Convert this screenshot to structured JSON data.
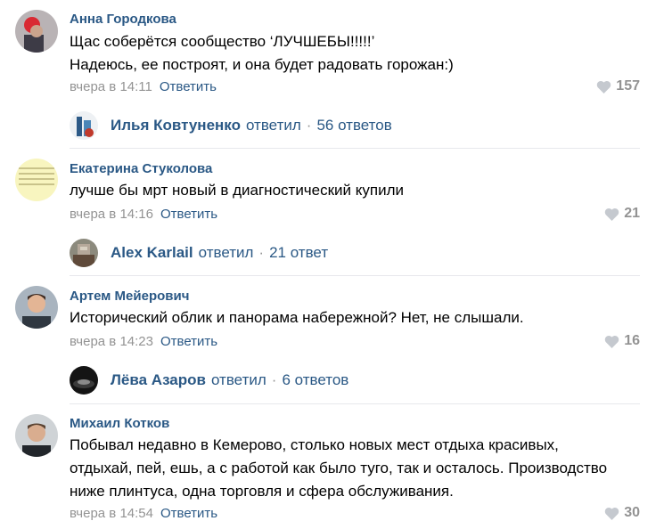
{
  "comments": [
    {
      "author": "Анна Городкова",
      "lines": [
        "Щас соберётся сообщество ‘ЛУЧШЕБЫ!!!!!’",
        "Надеюсь, ее построят, и она будет радовать горожан:)"
      ],
      "time": "вчера в 14:11",
      "reply_label": "Ответить",
      "likes": "157",
      "thread": {
        "name": "Илья Ковтуненко",
        "verb": "ответил",
        "count": "56 ответов"
      }
    },
    {
      "author": "Екатерина Стуколова",
      "lines": [
        "лучше бы мрт новый в диагностический купили"
      ],
      "time": "вчера в 14:16",
      "reply_label": "Ответить",
      "likes": "21",
      "thread": {
        "name": "Alex Karlail",
        "verb": "ответил",
        "count": "21 ответ"
      }
    },
    {
      "author": "Артем Мейерович",
      "lines": [
        "Исторический облик и панорама набережной? Нет, не слышали."
      ],
      "time": "вчера в 14:23",
      "reply_label": "Ответить",
      "likes": "16",
      "thread": {
        "name": "Лёва Азаров",
        "verb": "ответил",
        "count": "6 ответов"
      }
    },
    {
      "author": "Михаил Котков",
      "lines": [
        "Побывал недавно в Кемерово, столько новых мест отдыха красивых,",
        "отдыхай, пей, ешь, а с работой как было туго, так и осталось. Производство",
        "ниже плинтуса, одна торговля и сфера обслуживания."
      ],
      "time": "вчера в 14:54",
      "reply_label": "Ответить",
      "likes": "30"
    }
  ],
  "colors": {
    "link": "#2a5885",
    "muted": "#939393",
    "divider": "#e7e8ec"
  },
  "icons": {
    "like": "heart-icon"
  },
  "thread_separator": "·"
}
